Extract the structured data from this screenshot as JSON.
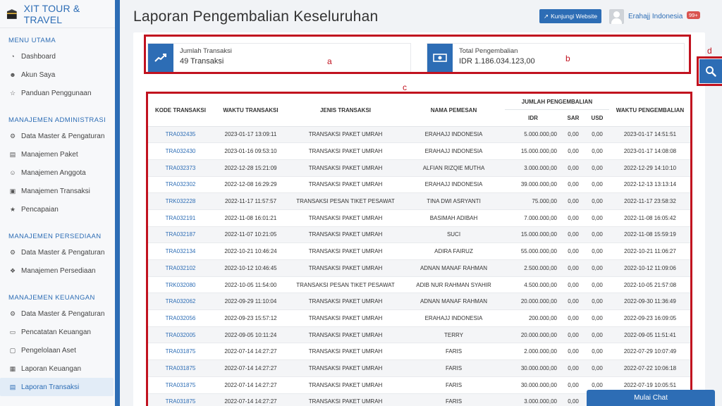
{
  "brand": {
    "name": "XIT TOUR & TRAVEL"
  },
  "sidebar": {
    "sections": [
      {
        "title": "MENU UTAMA",
        "items": [
          {
            "label": "Dashboard",
            "icon": "dashboard-icon"
          },
          {
            "label": "Akun Saya",
            "icon": "user-icon"
          },
          {
            "label": "Panduan Penggunaan",
            "icon": "lightbulb-icon"
          }
        ]
      },
      {
        "title": "MANAJEMEN ADMINISTRASI",
        "items": [
          {
            "label": "Data Master & Pengaturan",
            "icon": "cogs-icon"
          },
          {
            "label": "Manajemen Paket",
            "icon": "book-icon"
          },
          {
            "label": "Manajemen Anggota",
            "icon": "users-icon"
          },
          {
            "label": "Manajemen Transaksi",
            "icon": "cart-icon"
          },
          {
            "label": "Pencapaian",
            "icon": "star-icon"
          }
        ]
      },
      {
        "title": "MANAJEMEN PERSEDIAAN",
        "items": [
          {
            "label": "Data Master & Pengaturan",
            "icon": "cogs-icon"
          },
          {
            "label": "Manajemen Persediaan",
            "icon": "cubes-icon"
          }
        ]
      },
      {
        "title": "MANAJEMEN KEUANGAN",
        "items": [
          {
            "label": "Data Master & Pengaturan",
            "icon": "cogs-icon"
          },
          {
            "label": "Pencatatan Keuangan",
            "icon": "money-icon"
          },
          {
            "label": "Pengelolaan Aset",
            "icon": "inbox-icon"
          },
          {
            "label": "Laporan Keuangan",
            "icon": "report-icon"
          },
          {
            "label": "Laporan Transaksi",
            "icon": "book-icon",
            "active": true
          }
        ]
      }
    ]
  },
  "header": {
    "title": "Laporan Pengembalian Keseluruhan",
    "visit_button": "Kunjungi Website",
    "user_name": "Erahajj Indonesia",
    "notif_count": "99+"
  },
  "summary": {
    "transactions_label": "Jumlah Transaksi",
    "transactions_value": "49 Transaksi",
    "total_label": "Total Pengembalian",
    "total_value": "IDR 1.186.034.123,00"
  },
  "annotations": {
    "a": "a",
    "b": "b",
    "c": "c",
    "d": "d"
  },
  "table": {
    "headers": {
      "code": "KODE TRANSAKSI",
      "time": "WAKTU TRANSAKSI",
      "type": "JENIS TRANSAKSI",
      "name": "NAMA PEMESAN",
      "amount_group": "JUMLAH PENGEMBALIAN",
      "idr": "IDR",
      "sar": "SAR",
      "usd": "USD",
      "refund_time": "WAKTU PENGEMBALIAN"
    },
    "rows": [
      [
        "TRA032435",
        "2023-01-17 13:09:11",
        "TRANSAKSI PAKET UMRAH",
        "ERAHAJJ INDONESIA",
        "5.000.000,00",
        "0,00",
        "0,00",
        "2023-01-17 14:51:51"
      ],
      [
        "TRA032430",
        "2023-01-16 09:53:10",
        "TRANSAKSI PAKET UMRAH",
        "ERAHAJJ INDONESIA",
        "15.000.000,00",
        "0,00",
        "0,00",
        "2023-01-17 14:08:08"
      ],
      [
        "TRA032373",
        "2022-12-28 15:21:09",
        "TRANSAKSI PAKET UMRAH",
        "ALFIAN RIZQIE MUTHA",
        "3.000.000,00",
        "0,00",
        "0,00",
        "2022-12-29 14:10:10"
      ],
      [
        "TRA032302",
        "2022-12-08 16:29:29",
        "TRANSAKSI PAKET UMRAH",
        "ERAHAJJ INDONESIA",
        "39.000.000,00",
        "0,00",
        "0,00",
        "2022-12-13 13:13:14"
      ],
      [
        "TRK032228",
        "2022-11-17 11:57:57",
        "TRANSAKSI PESAN TIKET PESAWAT",
        "TINA DWI ASRYANTI",
        "75.000,00",
        "0,00",
        "0,00",
        "2022-11-17 23:58:32"
      ],
      [
        "TRA032191",
        "2022-11-08 16:01:21",
        "TRANSAKSI PAKET UMRAH",
        "BASIMAH ADIBAH",
        "7.000.000,00",
        "0,00",
        "0,00",
        "2022-11-08 16:05:42"
      ],
      [
        "TRA032187",
        "2022-11-07 10:21:05",
        "TRANSAKSI PAKET UMRAH",
        "SUCI",
        "15.000.000,00",
        "0,00",
        "0,00",
        "2022-11-08 15:59:19"
      ],
      [
        "TRA032134",
        "2022-10-21 10:46:24",
        "TRANSAKSI PAKET UMRAH",
        "ADIRA FAIRUZ",
        "55.000.000,00",
        "0,00",
        "0,00",
        "2022-10-21 11:06:27"
      ],
      [
        "TRA032102",
        "2022-10-12 10:46:45",
        "TRANSAKSI PAKET UMRAH",
        "ADNAN MANAF RAHMAN",
        "2.500.000,00",
        "0,00",
        "0,00",
        "2022-10-12 11:09:06"
      ],
      [
        "TRK032080",
        "2022-10-05 11:54:00",
        "TRANSAKSI PESAN TIKET PESAWAT",
        "ADIB NUR RAHMAN SYAHIR",
        "4.500.000,00",
        "0,00",
        "0,00",
        "2022-10-05 21:57:08"
      ],
      [
        "TRA032062",
        "2022-09-29 11:10:04",
        "TRANSAKSI PAKET UMRAH",
        "ADNAN MANAF RAHMAN",
        "20.000.000,00",
        "0,00",
        "0,00",
        "2022-09-30 11:36:49"
      ],
      [
        "TRA032056",
        "2022-09-23 15:57:12",
        "TRANSAKSI PAKET UMRAH",
        "ERAHAJJ INDONESIA",
        "200.000,00",
        "0,00",
        "0,00",
        "2022-09-23 16:09:05"
      ],
      [
        "TRA032005",
        "2022-09-05 10:11:24",
        "TRANSAKSI PAKET UMRAH",
        "TERRY",
        "20.000.000,00",
        "0,00",
        "0,00",
        "2022-09-05 11:51:41"
      ],
      [
        "TRA031875",
        "2022-07-14 14:27:27",
        "TRANSAKSI PAKET UMRAH",
        "FARIS",
        "2.000.000,00",
        "0,00",
        "0,00",
        "2022-07-29 10:07:49"
      ],
      [
        "TRA031875",
        "2022-07-14 14:27:27",
        "TRANSAKSI PAKET UMRAH",
        "FARIS",
        "30.000.000,00",
        "0,00",
        "0,00",
        "2022-07-22 10:06:18"
      ],
      [
        "TRA031875",
        "2022-07-14 14:27:27",
        "TRANSAKSI PAKET UMRAH",
        "FARIS",
        "30.000.000,00",
        "0,00",
        "0,00",
        "2022-07-19 10:05:51"
      ],
      [
        "TRA031875",
        "2022-07-14 14:27:27",
        "TRANSAKSI PAKET UMRAH",
        "FARIS",
        "3.000.000,00",
        "0,00",
        "0,00",
        ""
      ]
    ]
  },
  "chat": {
    "label": "Mulai Chat"
  },
  "colors": {
    "primary": "#2d6db5",
    "annotation": "#c1121f",
    "badge": "#d9534f"
  }
}
